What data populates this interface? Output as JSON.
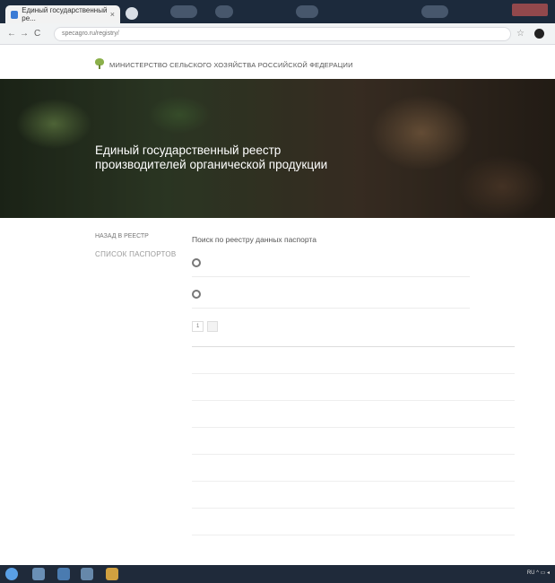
{
  "browser": {
    "tab_title": "Единый государственный ре...",
    "url": "specagro.ru/registry/",
    "back": "←",
    "forward": "→",
    "reload": "C"
  },
  "site": {
    "ministry": "МИНИСТЕРСТВО СЕЛЬСКОГО ХОЗЯЙСТВА РОССИЙСКОЙ ФЕДЕРАЦИИ",
    "hero_title": "Единый государственный реестр производителей органической продукции",
    "hero_subtitle": ""
  },
  "sidebar": {
    "title": "НАЗАД В РЕЕСТР",
    "head": "СПИСОК ПАСПОРТОВ",
    "items": [
      "",
      "",
      "",
      "",
      "",
      "",
      "",
      "",
      "",
      ""
    ]
  },
  "main": {
    "title": "Поиск по реестру данных паспорта",
    "radio1": "",
    "radio2": "",
    "found": "",
    "pager": [
      "1",
      ""
    ],
    "columns": [
      "",
      "",
      "",
      "",
      "",
      "",
      ""
    ],
    "rows": [
      [
        "",
        "",
        "",
        "",
        "",
        "",
        "",
        ""
      ],
      [
        "",
        "",
        "",
        "",
        "",
        "",
        "",
        ""
      ],
      [
        "",
        "",
        "",
        "",
        "",
        "",
        "",
        ""
      ],
      [
        "",
        "",
        "",
        "",
        "",
        "",
        "",
        ""
      ],
      [
        "",
        "",
        "",
        "",
        "",
        "",
        "",
        ""
      ],
      [
        "",
        "",
        "",
        "",
        "",
        "",
        "",
        ""
      ],
      [
        "",
        "",
        "",
        "",
        "",
        "",
        "",
        ""
      ]
    ]
  },
  "taskbar": {
    "tray": "RU ^ ▭ ◂"
  }
}
